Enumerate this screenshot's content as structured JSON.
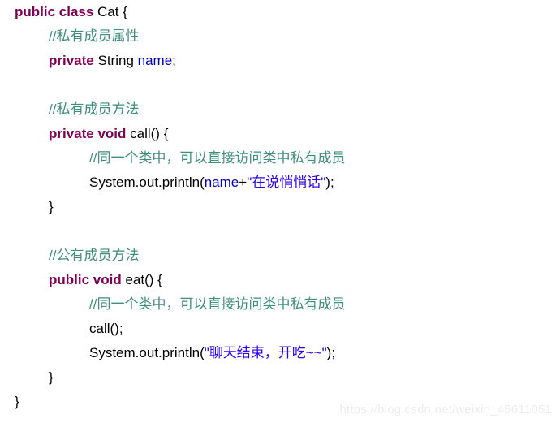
{
  "editor": {
    "language": "java",
    "background_color": "#FFFFFF",
    "syntax_colors": {
      "keyword": "#7F0055",
      "comment": "#3F8E7E",
      "string": "#2A00FF",
      "field": "#0000C0",
      "static_field": "#0000C0",
      "plain": "#000000"
    }
  },
  "code": {
    "lines": [
      {
        "indent": 0,
        "tokens": [
          {
            "text": "public class ",
            "type": "keyword"
          },
          {
            "text": "Cat {",
            "type": "plain"
          }
        ]
      },
      {
        "indent": 1,
        "tokens": [
          {
            "text": "//私有成员属性",
            "type": "comment"
          }
        ]
      },
      {
        "indent": 1,
        "tokens": [
          {
            "text": "private ",
            "type": "keyword"
          },
          {
            "text": "String ",
            "type": "plain"
          },
          {
            "text": "name",
            "type": "field"
          },
          {
            "text": ";",
            "type": "plain"
          }
        ]
      },
      {
        "indent": 0,
        "blank": true,
        "tokens": []
      },
      {
        "indent": 1,
        "tokens": [
          {
            "text": "//私有成员方法",
            "type": "comment"
          }
        ]
      },
      {
        "indent": 1,
        "tokens": [
          {
            "text": "private void ",
            "type": "keyword"
          },
          {
            "text": "call() {",
            "type": "plain"
          }
        ]
      },
      {
        "indent": 2,
        "tokens": [
          {
            "text": "//同一个类中，可以直接访问类中私有成员",
            "type": "comment"
          }
        ]
      },
      {
        "indent": 2,
        "tokens": [
          {
            "text": "System.",
            "type": "plain"
          },
          {
            "text": "out",
            "type": "static_field"
          },
          {
            "text": ".println(",
            "type": "plain"
          },
          {
            "text": "name",
            "type": "field"
          },
          {
            "text": "+",
            "type": "plain"
          },
          {
            "text": "\"在说悄悄话\"",
            "type": "string"
          },
          {
            "text": ");",
            "type": "plain"
          }
        ]
      },
      {
        "indent": 1,
        "tokens": [
          {
            "text": "}",
            "type": "plain"
          }
        ]
      },
      {
        "indent": 0,
        "blank": true,
        "tokens": []
      },
      {
        "indent": 1,
        "tokens": [
          {
            "text": "//公有成员方法",
            "type": "comment"
          }
        ]
      },
      {
        "indent": 1,
        "tokens": [
          {
            "text": "public void ",
            "type": "keyword"
          },
          {
            "text": "eat() {",
            "type": "plain"
          }
        ]
      },
      {
        "indent": 2,
        "tokens": [
          {
            "text": "//同一个类中，可以直接访问类中私有成员",
            "type": "comment"
          }
        ]
      },
      {
        "indent": 2,
        "tokens": [
          {
            "text": "call();",
            "type": "plain"
          }
        ]
      },
      {
        "indent": 2,
        "tokens": [
          {
            "text": "System.",
            "type": "plain"
          },
          {
            "text": "out",
            "type": "static_field"
          },
          {
            "text": ".println(",
            "type": "plain"
          },
          {
            "text": "\"聊天结束，开吃~~\"",
            "type": "string"
          },
          {
            "text": ");",
            "type": "plain"
          }
        ]
      },
      {
        "indent": 1,
        "tokens": [
          {
            "text": "}",
            "type": "plain"
          }
        ]
      },
      {
        "indent": 0,
        "tokens": [
          {
            "text": "}",
            "type": "plain"
          }
        ]
      }
    ]
  },
  "watermark": {
    "text": "https://blog.csdn.net/weixin_45611051",
    "color": "#ECECEC"
  }
}
